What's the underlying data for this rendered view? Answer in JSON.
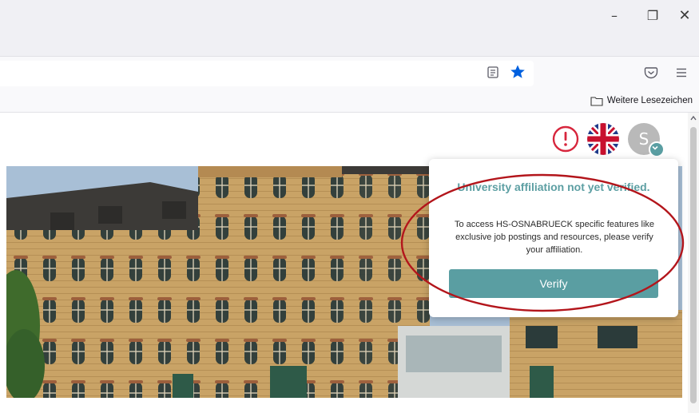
{
  "window_controls": {
    "minimize": "–",
    "restore": "❐",
    "close": "✕"
  },
  "toolbar": {
    "icons": [
      "reader-view-icon",
      "bookmark-star-icon",
      "pocket-icon",
      "hamburger-menu-icon"
    ],
    "star_color": "#0060df"
  },
  "bookmarks_bar": {
    "other_bookmarks_label": "Weitere Lesezeichen"
  },
  "header": {
    "alert_color": "#d7263d",
    "language": "en",
    "avatar_initial": "S"
  },
  "popup": {
    "title": "University affiliation not yet verified.",
    "body": "To access HS-OSNABRUECK specific features like exclusive job postings and resources, please verify your affiliation.",
    "button_label": "Verify",
    "accent_color": "#5a9ea2"
  },
  "annotation": {
    "highlight_color": "#b3151b"
  }
}
